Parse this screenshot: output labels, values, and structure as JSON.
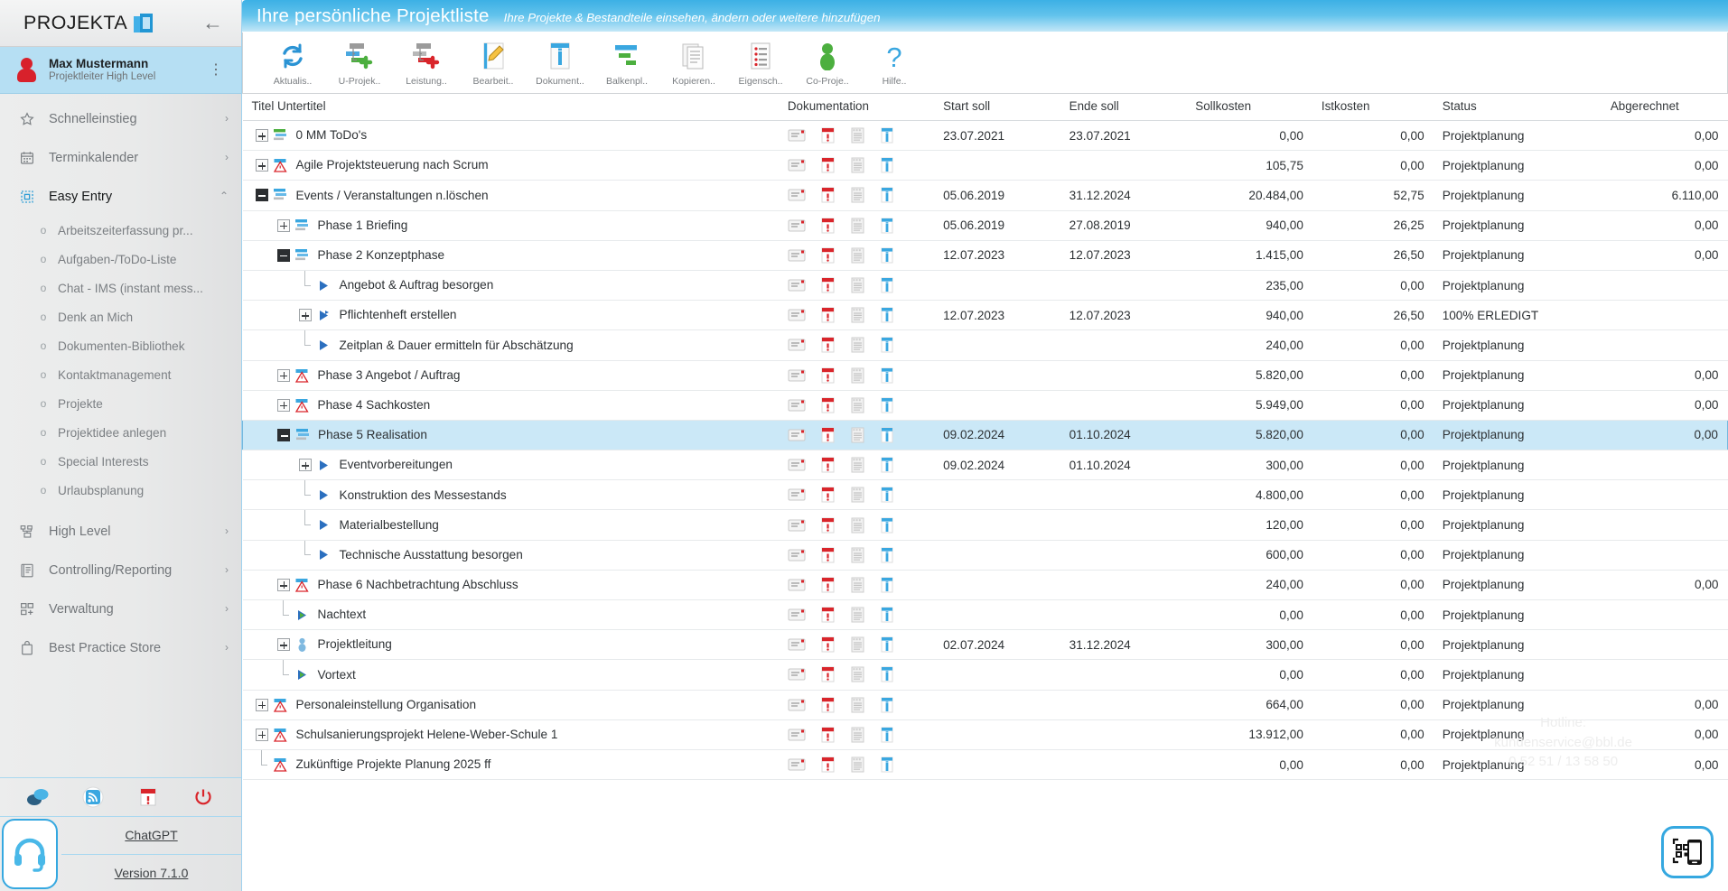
{
  "brand": {
    "name": "PROJEKTA",
    "collapse_icon": "arrow-left-icon"
  },
  "user": {
    "name": "Max Mustermann",
    "role": "Projektleiter High Level",
    "menu_icon": "more-vertical-icon"
  },
  "sidebar": {
    "items": [
      {
        "label": "Schnelleinstieg",
        "icon": "star-icon",
        "chevron": "›",
        "active": false
      },
      {
        "label": "Terminkalender",
        "icon": "calendar-icon",
        "chevron": "›",
        "active": false
      },
      {
        "label": "Easy Entry",
        "icon": "dashed-square-icon",
        "chevron": "⌃",
        "active": true
      }
    ],
    "sub_items": [
      {
        "label": "Arbeitszeiterfassung pr..."
      },
      {
        "label": "Aufgaben-/ToDo-Liste"
      },
      {
        "label": "Chat - IMS (instant mess..."
      },
      {
        "label": "Denk an Mich"
      },
      {
        "label": "Dokumenten-Bibliothek"
      },
      {
        "label": "Kontaktmanagement"
      },
      {
        "label": "Projekte"
      },
      {
        "label": "Projektidee anlegen"
      },
      {
        "label": "Special Interests"
      },
      {
        "label": "Urlaubsplanung"
      }
    ],
    "items_bottom": [
      {
        "label": "High Level",
        "icon": "org-chart-icon",
        "chevron": "›"
      },
      {
        "label": "Controlling/Reporting",
        "icon": "report-icon",
        "chevron": "›"
      },
      {
        "label": "Verwaltung",
        "icon": "grid-plus-icon",
        "chevron": "›"
      },
      {
        "label": "Best Practice Store",
        "icon": "bag-icon",
        "chevron": "›"
      }
    ],
    "quick_icons": [
      {
        "name": "chat-bubbles-icon"
      },
      {
        "name": "rss-feed-icon"
      },
      {
        "name": "alert-calendar-icon"
      },
      {
        "name": "power-off-icon"
      }
    ],
    "footer": {
      "headset_icon": "headset-icon",
      "chatgpt_link": "ChatGPT",
      "version_link": "Version 7.1.0"
    }
  },
  "header": {
    "title": "Ihre persönliche Projektliste",
    "subtitle": "Ihre Projekte & Bestandteile einsehen, ändern oder weitere hinzufügen"
  },
  "toolbar": {
    "buttons": [
      {
        "label": "Aktualis..",
        "icon": "refresh-icon"
      },
      {
        "label": "U-Projek..",
        "icon": "subproject-add-icon"
      },
      {
        "label": "Leistung..",
        "icon": "task-add-icon"
      },
      {
        "label": "Bearbeit..",
        "icon": "edit-pencil-icon"
      },
      {
        "label": "Dokument..",
        "icon": "info-document-icon"
      },
      {
        "label": "Balkenpl..",
        "icon": "gantt-chart-icon"
      },
      {
        "label": "Kopieren..",
        "icon": "copy-pages-icon"
      },
      {
        "label": "Eigensch..",
        "icon": "properties-list-icon"
      },
      {
        "label": "Co-Proje..",
        "icon": "person-icon"
      },
      {
        "label": "Hilfe..",
        "icon": "question-mark-icon"
      }
    ]
  },
  "table": {
    "columns": [
      "Titel Untertitel",
      "Dokumentation",
      "Start soll",
      "Ende soll",
      "Sollkosten",
      "Istkosten",
      "Status",
      "Abgerechnet"
    ],
    "doc_icons": [
      "note-icon",
      "red-alert-doc-icon",
      "document-lines-icon",
      "info-column-icon"
    ],
    "rows": [
      {
        "indent": 0,
        "toggle": "plus",
        "icon": "green-task-icon",
        "title": "0 MM ToDo's",
        "start": "23.07.2021",
        "end": "23.07.2021",
        "soll": "0,00",
        "ist": "0,00",
        "status": "Projektplanung",
        "abger": "0,00",
        "selected": false
      },
      {
        "indent": 0,
        "toggle": "plus",
        "icon": "project-alert-icon",
        "title": "Agile Projektsteuerung nach Scrum",
        "start": "",
        "end": "",
        "soll": "105,75",
        "ist": "0,00",
        "status": "Projektplanung",
        "abger": "0,00",
        "selected": false
      },
      {
        "indent": 0,
        "toggle": "minus-solid",
        "icon": "blue-task-icon",
        "title": "Events / Veranstaltungen n.löschen",
        "start": "05.06.2019",
        "end": "31.12.2024",
        "soll": "20.484,00",
        "ist": "52,75",
        "status": "Projektplanung",
        "abger": "6.110,00",
        "selected": false
      },
      {
        "indent": 1,
        "toggle": "plus",
        "icon": "blue-task-icon",
        "title": "Phase 1 Briefing",
        "start": "05.06.2019",
        "end": "27.08.2019",
        "soll": "940,00",
        "ist": "26,25",
        "status": "Projektplanung",
        "abger": "0,00",
        "selected": false
      },
      {
        "indent": 1,
        "toggle": "minus-solid",
        "icon": "blue-task-icon",
        "title": "Phase 2 Konzeptphase",
        "start": "12.07.2023",
        "end": "12.07.2023",
        "soll": "1.415,00",
        "ist": "26,50",
        "status": "Projektplanung",
        "abger": "0,00",
        "selected": false
      },
      {
        "indent": 2,
        "toggle": "leaf",
        "icon": "blue-arrow-icon",
        "title": "Angebot & Auftrag besorgen",
        "start": "",
        "end": "",
        "soll": "235,00",
        "ist": "0,00",
        "status": "Projektplanung",
        "abger": "",
        "selected": false
      },
      {
        "indent": 2,
        "toggle": "plus",
        "icon": "flag-arrow-icon",
        "title": "Pflichtenheft erstellen",
        "start": "12.07.2023",
        "end": "12.07.2023",
        "soll": "940,00",
        "ist": "26,50",
        "status": "100% ERLEDIGT",
        "abger": "",
        "selected": false
      },
      {
        "indent": 2,
        "toggle": "leaf",
        "icon": "blue-arrow-icon",
        "title": "Zeitplan & Dauer ermitteln für Abschätzung",
        "start": "",
        "end": "",
        "soll": "240,00",
        "ist": "0,00",
        "status": "Projektplanung",
        "abger": "",
        "selected": false
      },
      {
        "indent": 1,
        "toggle": "plus",
        "icon": "project-alert-icon",
        "title": "Phase 3 Angebot / Auftrag",
        "start": "",
        "end": "",
        "soll": "5.820,00",
        "ist": "0,00",
        "status": "Projektplanung",
        "abger": "0,00",
        "selected": false
      },
      {
        "indent": 1,
        "toggle": "plus",
        "icon": "project-alert-icon",
        "title": "Phase 4 Sachkosten",
        "start": "",
        "end": "",
        "soll": "5.949,00",
        "ist": "0,00",
        "status": "Projektplanung",
        "abger": "0,00",
        "selected": false
      },
      {
        "indent": 1,
        "toggle": "minus-solid",
        "icon": "blue-task-icon",
        "title": "Phase 5 Realisation",
        "start": "09.02.2024",
        "end": "01.10.2024",
        "soll": "5.820,00",
        "ist": "0,00",
        "status": "Projektplanung",
        "abger": "0,00",
        "selected": true
      },
      {
        "indent": 2,
        "toggle": "plus",
        "icon": "blue-arrow-icon",
        "title": "Eventvorbereitungen",
        "start": "09.02.2024",
        "end": "01.10.2024",
        "soll": "300,00",
        "ist": "0,00",
        "status": "Projektplanung",
        "abger": "",
        "selected": false
      },
      {
        "indent": 2,
        "toggle": "leaf",
        "icon": "blue-arrow-icon",
        "title": "Konstruktion des Messestands",
        "start": "",
        "end": "",
        "soll": "4.800,00",
        "ist": "0,00",
        "status": "Projektplanung",
        "abger": "",
        "selected": false
      },
      {
        "indent": 2,
        "toggle": "leaf",
        "icon": "blue-arrow-icon",
        "title": "Materialbestellung",
        "start": "",
        "end": "",
        "soll": "120,00",
        "ist": "0,00",
        "status": "Projektplanung",
        "abger": "",
        "selected": false
      },
      {
        "indent": 2,
        "toggle": "leaf",
        "icon": "blue-arrow-icon",
        "title": "Technische Ausstattung besorgen",
        "start": "",
        "end": "",
        "soll": "600,00",
        "ist": "0,00",
        "status": "Projektplanung",
        "abger": "",
        "selected": false
      },
      {
        "indent": 1,
        "toggle": "plus",
        "icon": "project-alert-icon",
        "title": "Phase 6 Nachbetrachtung Abschluss",
        "start": "",
        "end": "",
        "soll": "240,00",
        "ist": "0,00",
        "status": "Projektplanung",
        "abger": "0,00",
        "selected": false
      },
      {
        "indent": 1,
        "toggle": "leaf",
        "icon": "green-arrow-icon",
        "title": "Nachtext",
        "start": "",
        "end": "",
        "soll": "0,00",
        "ist": "0,00",
        "status": "Projektplanung",
        "abger": "",
        "selected": false
      },
      {
        "indent": 1,
        "toggle": "plus",
        "icon": "person-small-icon",
        "title": "Projektleitung",
        "start": "02.07.2024",
        "end": "31.12.2024",
        "soll": "300,00",
        "ist": "0,00",
        "status": "Projektplanung",
        "abger": "",
        "selected": false
      },
      {
        "indent": 1,
        "toggle": "leaf",
        "icon": "green-arrow-icon",
        "title": "Vortext",
        "start": "",
        "end": "",
        "soll": "0,00",
        "ist": "0,00",
        "status": "Projektplanung",
        "abger": "",
        "selected": false
      },
      {
        "indent": 0,
        "toggle": "plus",
        "icon": "project-alert-icon",
        "title": "Personaleinstellung Organisation",
        "start": "",
        "end": "",
        "soll": "664,00",
        "ist": "0,00",
        "status": "Projektplanung",
        "abger": "0,00",
        "selected": false
      },
      {
        "indent": 0,
        "toggle": "plus",
        "icon": "project-alert-icon",
        "title": "Schulsanierungsprojekt Helene-Weber-Schule 1",
        "start": "",
        "end": "",
        "soll": "13.912,00",
        "ist": "0,00",
        "status": "Projektplanung",
        "abger": "0,00",
        "selected": false
      },
      {
        "indent": 0,
        "toggle": "leaf",
        "icon": "project-alert-icon",
        "title": "Zukünftige Projekte Planung 2025 ff",
        "start": "",
        "end": "",
        "soll": "0,00",
        "ist": "0,00",
        "status": "Projektplanung",
        "abger": "0,00",
        "selected": false
      }
    ]
  },
  "watermark": {
    "line1": "Hotline:",
    "line2": "kundenservice@bbl.de",
    "line3": "0 52 51 / 13 58 50"
  },
  "qr_button": {
    "icon": "qr-mobile-scan-icon"
  },
  "colors": {
    "accent": "#35a8e0",
    "title_gradient_start": "#3cb0e5",
    "selection": "#cbe8f7",
    "user_panel": "#b6dff3",
    "alert_red": "#d8212b",
    "task_green": "#4caf3f"
  }
}
